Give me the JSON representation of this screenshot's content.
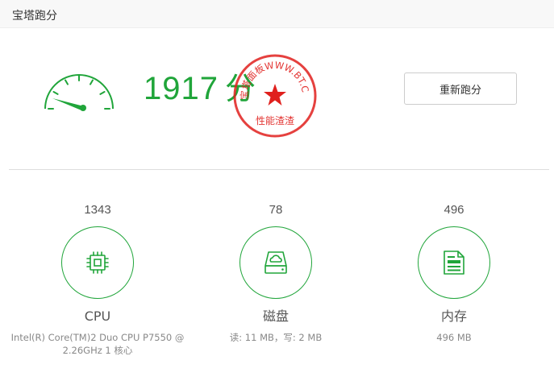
{
  "window": {
    "title": "宝塔跑分"
  },
  "summary": {
    "score": "1917",
    "unit": "分",
    "rebench_label": "重新跑分",
    "gauge_level": 0.15,
    "stamp": {
      "top_text": "宝塔面板WWW.BT.CN",
      "bottom_text": "性能渣渣"
    }
  },
  "metrics": {
    "cpu": {
      "value": "1343",
      "label": "CPU",
      "detail": "Intel(R) Core(TM)2 Duo CPU P7550 @ 2.26GHz 1 核心",
      "icon": "cpu-icon"
    },
    "disk": {
      "value": "78",
      "label": "磁盘",
      "detail": "读: 11 MB，写: 2 MB",
      "icon": "disk-icon"
    },
    "memory": {
      "value": "496",
      "label": "内存",
      "detail": "496 MB",
      "icon": "memory-icon"
    }
  },
  "colors": {
    "accent": "#20a53a",
    "stamp": "#e0201d"
  }
}
